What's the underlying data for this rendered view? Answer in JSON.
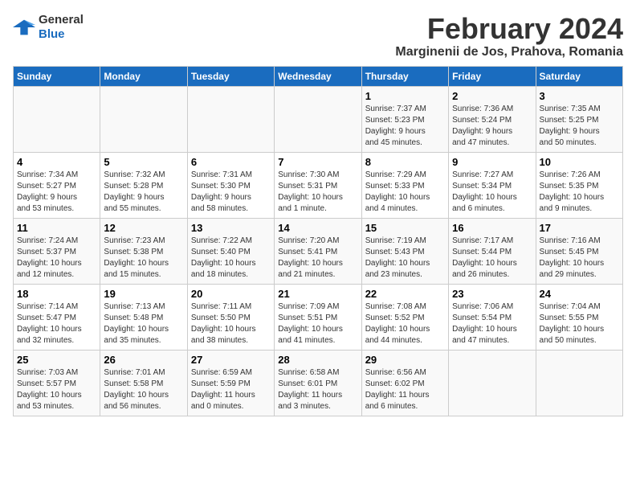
{
  "header": {
    "logo_general": "General",
    "logo_blue": "Blue",
    "month_title": "February 2024",
    "location": "Marginenii de Jos, Prahova, Romania"
  },
  "days_of_week": [
    "Sunday",
    "Monday",
    "Tuesday",
    "Wednesday",
    "Thursday",
    "Friday",
    "Saturday"
  ],
  "weeks": [
    [
      {
        "day": "",
        "info": ""
      },
      {
        "day": "",
        "info": ""
      },
      {
        "day": "",
        "info": ""
      },
      {
        "day": "",
        "info": ""
      },
      {
        "day": "1",
        "info": "Sunrise: 7:37 AM\nSunset: 5:23 PM\nDaylight: 9 hours\nand 45 minutes."
      },
      {
        "day": "2",
        "info": "Sunrise: 7:36 AM\nSunset: 5:24 PM\nDaylight: 9 hours\nand 47 minutes."
      },
      {
        "day": "3",
        "info": "Sunrise: 7:35 AM\nSunset: 5:25 PM\nDaylight: 9 hours\nand 50 minutes."
      }
    ],
    [
      {
        "day": "4",
        "info": "Sunrise: 7:34 AM\nSunset: 5:27 PM\nDaylight: 9 hours\nand 53 minutes."
      },
      {
        "day": "5",
        "info": "Sunrise: 7:32 AM\nSunset: 5:28 PM\nDaylight: 9 hours\nand 55 minutes."
      },
      {
        "day": "6",
        "info": "Sunrise: 7:31 AM\nSunset: 5:30 PM\nDaylight: 9 hours\nand 58 minutes."
      },
      {
        "day": "7",
        "info": "Sunrise: 7:30 AM\nSunset: 5:31 PM\nDaylight: 10 hours\nand 1 minute."
      },
      {
        "day": "8",
        "info": "Sunrise: 7:29 AM\nSunset: 5:33 PM\nDaylight: 10 hours\nand 4 minutes."
      },
      {
        "day": "9",
        "info": "Sunrise: 7:27 AM\nSunset: 5:34 PM\nDaylight: 10 hours\nand 6 minutes."
      },
      {
        "day": "10",
        "info": "Sunrise: 7:26 AM\nSunset: 5:35 PM\nDaylight: 10 hours\nand 9 minutes."
      }
    ],
    [
      {
        "day": "11",
        "info": "Sunrise: 7:24 AM\nSunset: 5:37 PM\nDaylight: 10 hours\nand 12 minutes."
      },
      {
        "day": "12",
        "info": "Sunrise: 7:23 AM\nSunset: 5:38 PM\nDaylight: 10 hours\nand 15 minutes."
      },
      {
        "day": "13",
        "info": "Sunrise: 7:22 AM\nSunset: 5:40 PM\nDaylight: 10 hours\nand 18 minutes."
      },
      {
        "day": "14",
        "info": "Sunrise: 7:20 AM\nSunset: 5:41 PM\nDaylight: 10 hours\nand 21 minutes."
      },
      {
        "day": "15",
        "info": "Sunrise: 7:19 AM\nSunset: 5:43 PM\nDaylight: 10 hours\nand 23 minutes."
      },
      {
        "day": "16",
        "info": "Sunrise: 7:17 AM\nSunset: 5:44 PM\nDaylight: 10 hours\nand 26 minutes."
      },
      {
        "day": "17",
        "info": "Sunrise: 7:16 AM\nSunset: 5:45 PM\nDaylight: 10 hours\nand 29 minutes."
      }
    ],
    [
      {
        "day": "18",
        "info": "Sunrise: 7:14 AM\nSunset: 5:47 PM\nDaylight: 10 hours\nand 32 minutes."
      },
      {
        "day": "19",
        "info": "Sunrise: 7:13 AM\nSunset: 5:48 PM\nDaylight: 10 hours\nand 35 minutes."
      },
      {
        "day": "20",
        "info": "Sunrise: 7:11 AM\nSunset: 5:50 PM\nDaylight: 10 hours\nand 38 minutes."
      },
      {
        "day": "21",
        "info": "Sunrise: 7:09 AM\nSunset: 5:51 PM\nDaylight: 10 hours\nand 41 minutes."
      },
      {
        "day": "22",
        "info": "Sunrise: 7:08 AM\nSunset: 5:52 PM\nDaylight: 10 hours\nand 44 minutes."
      },
      {
        "day": "23",
        "info": "Sunrise: 7:06 AM\nSunset: 5:54 PM\nDaylight: 10 hours\nand 47 minutes."
      },
      {
        "day": "24",
        "info": "Sunrise: 7:04 AM\nSunset: 5:55 PM\nDaylight: 10 hours\nand 50 minutes."
      }
    ],
    [
      {
        "day": "25",
        "info": "Sunrise: 7:03 AM\nSunset: 5:57 PM\nDaylight: 10 hours\nand 53 minutes."
      },
      {
        "day": "26",
        "info": "Sunrise: 7:01 AM\nSunset: 5:58 PM\nDaylight: 10 hours\nand 56 minutes."
      },
      {
        "day": "27",
        "info": "Sunrise: 6:59 AM\nSunset: 5:59 PM\nDaylight: 11 hours\nand 0 minutes."
      },
      {
        "day": "28",
        "info": "Sunrise: 6:58 AM\nSunset: 6:01 PM\nDaylight: 11 hours\nand 3 minutes."
      },
      {
        "day": "29",
        "info": "Sunrise: 6:56 AM\nSunset: 6:02 PM\nDaylight: 11 hours\nand 6 minutes."
      },
      {
        "day": "",
        "info": ""
      },
      {
        "day": "",
        "info": ""
      }
    ]
  ]
}
